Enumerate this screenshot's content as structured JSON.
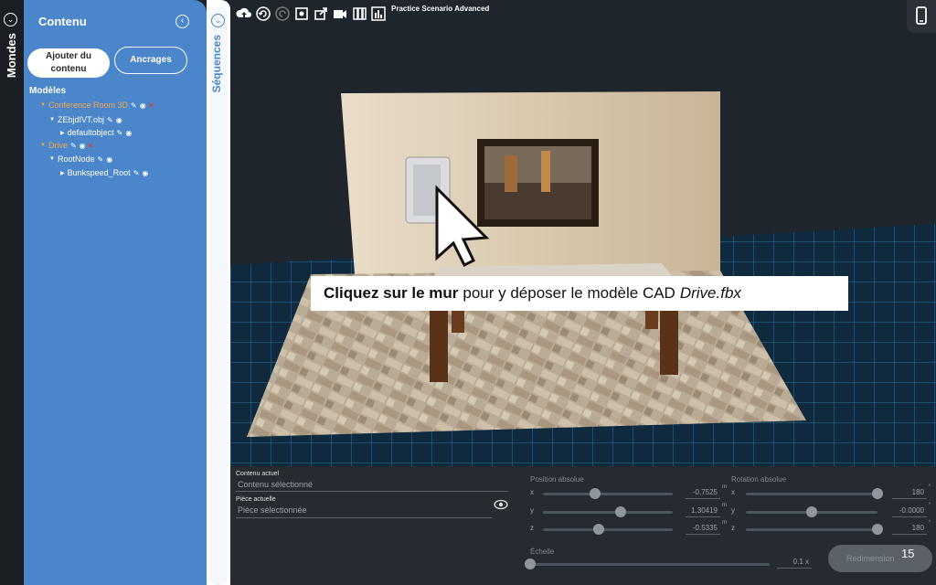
{
  "left_rail": {
    "label": "Mondes"
  },
  "panel": {
    "title": "Contenu",
    "add_button": "Ajouter du contenu",
    "anchors_button": "Ancrages",
    "models_label": "Modèles",
    "tree": [
      {
        "label": "Conference Room 3D",
        "level": 0,
        "orange": true,
        "delete": true
      },
      {
        "label": "ZEbjdIVT.obj",
        "level": 1,
        "orange": false,
        "delete": false
      },
      {
        "label": "defaultobject",
        "level": 2,
        "orange": false,
        "delete": false
      },
      {
        "label": "Drive",
        "level": 0,
        "orange": true,
        "delete": true
      },
      {
        "label": "RootNode",
        "level": 1,
        "orange": false,
        "delete": false
      },
      {
        "label": "Bunkspeed_Root",
        "level": 2,
        "orange": false,
        "delete": false
      }
    ]
  },
  "sequences_rail": {
    "label": "Séquences"
  },
  "toolbar": {
    "icons": [
      "cloud-upload-icon",
      "undo-icon",
      "redo-icon",
      "screenshot-icon",
      "share-icon",
      "video-icon",
      "book-icon",
      "chart-icon"
    ],
    "scenario_title": "Practice Scenario Advanced"
  },
  "instruction": {
    "bold": "Cliquez sur le mur",
    "text": "pour y déposer le modèle CAD",
    "italic": "Drive.fbx"
  },
  "bottom": {
    "current_content_label": "Contenu actuel",
    "current_content_value": "Contenu sélectionné",
    "current_room_label": "Pièce actuelle",
    "current_room_value": "Pièce sélectionnée",
    "position_label": "Position absolue",
    "rotation_label": "Rotation absolue",
    "scale_label": "Échelle",
    "position": [
      {
        "axis": "x",
        "value": "-0.7525",
        "unit": "m",
        "fraction": 0.4
      },
      {
        "axis": "y",
        "value": "1.30419",
        "unit": "m",
        "fraction": 0.6
      },
      {
        "axis": "z",
        "value": "-0.5335",
        "unit": "m",
        "fraction": 0.43
      }
    ],
    "rotation": [
      {
        "axis": "x",
        "value": "180",
        "unit": "°",
        "fraction": 1.0
      },
      {
        "axis": "y",
        "value": "-0.0000",
        "unit": "°",
        "fraction": 0.5
      },
      {
        "axis": "z",
        "value": "180",
        "unit": "°",
        "fraction": 1.0
      }
    ],
    "scale_value": "0.1",
    "scale_unit": "x",
    "resize_button": "Redimension",
    "page_number": "15"
  }
}
